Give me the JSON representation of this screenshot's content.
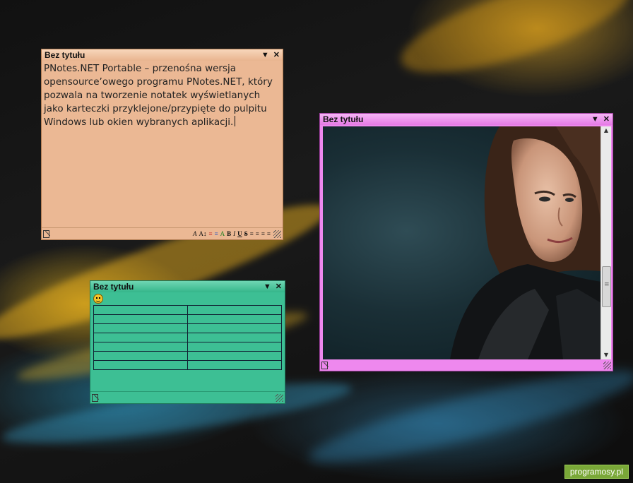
{
  "notes": {
    "orange": {
      "title": "Bez tytułu",
      "text": "PNotes.NET Portable – przenośna wersja opensource’owego programu PNotes.NET, który pozwala na tworzenie notatek wyświetlanych jako karteczki przyklejone/przypięte do pulpitu Windows lub okien wybranych aplikacji.",
      "format_buttons": [
        "A",
        "A↕",
        "≡",
        "≡",
        "A",
        "B",
        "I",
        "U",
        "S",
        "≡",
        "≡",
        "≡",
        "≡"
      ]
    },
    "green": {
      "title": "Bez tytułu",
      "table_rows": 7,
      "table_cols": 2
    },
    "pink": {
      "title": "Bez tytułu"
    }
  },
  "controls": {
    "dropdown_glyph": "▼",
    "close_glyph": "✕"
  },
  "watermark": "programosy.pl",
  "colors": {
    "orange_note_bg": "#ebb894",
    "orange_title_bg": "#f2c9a8",
    "green_note_bg": "#3dbf94",
    "pink_note_bg": "#ee88ee",
    "accent_watermark": "#7aa838"
  },
  "icons": [
    "dropdown-arrow-icon",
    "close-icon",
    "pin-icon",
    "resize-grip-icon",
    "smiley-icon"
  ]
}
